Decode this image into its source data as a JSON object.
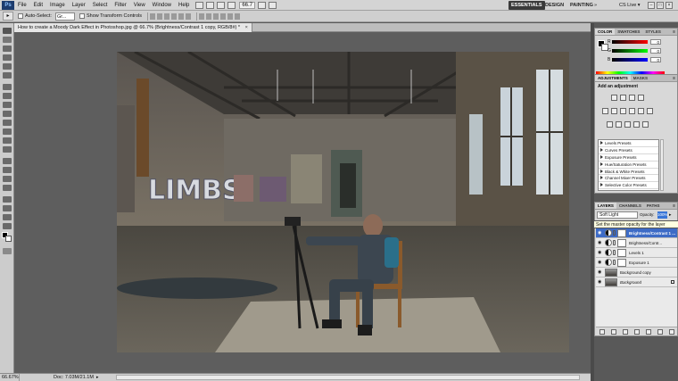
{
  "menubar": {
    "logo": "Ps",
    "items": [
      "File",
      "Edit",
      "Image",
      "Layer",
      "Select",
      "Filter",
      "View",
      "Window",
      "Help"
    ],
    "zoom": "66.7",
    "workspaces": [
      "ESSENTIALS",
      "DESIGN",
      "PAINTING",
      "»"
    ],
    "cs_live": "CS Live ▾",
    "window_buttons": [
      "–",
      "□",
      "×"
    ]
  },
  "options": {
    "auto_select_label": "Auto-Select:",
    "auto_select_value": "Gr...",
    "transform_label": "Show Transform Controls"
  },
  "document": {
    "tab_title": "How to create a Moody Dark Effect in Photoshop.jpg @ 66.7% (Brightness/Contrast 1 copy, RGB/8#) *",
    "close": "×"
  },
  "status": {
    "zoom": "66.67%",
    "doc": "Doc: 7.03M/21.1M",
    "arrow": "▸"
  },
  "color_panel": {
    "tabs": [
      "COLOR",
      "SWATCHES",
      "STYLES"
    ],
    "sliders": [
      {
        "label": "R",
        "value": "0"
      },
      {
        "label": "G",
        "value": "0"
      },
      {
        "label": "B",
        "value": "0"
      }
    ]
  },
  "adjustments_panel": {
    "tabs": [
      "ADJUSTMENTS",
      "MASKS"
    ],
    "title": "Add an adjustment",
    "presets": [
      "Levels Presets",
      "Curves Presets",
      "Exposure Presets",
      "Hue/Saturation Presets",
      "Black & White Presets",
      "Channel Mixer Presets",
      "Selective Color Presets"
    ]
  },
  "layers_panel": {
    "tabs": [
      "LAYERS",
      "CHANNELS",
      "PATHS"
    ],
    "blend_mode": "Soft Light",
    "opacity_label": "Opacity:",
    "opacity_value": "100%",
    "tooltip": "Set the master opacity for the layer",
    "layers": [
      {
        "name": "Brightness/Contrast 1 ...",
        "selected": true
      },
      {
        "name": "Brightness/Contr..."
      },
      {
        "name": "Levels 1"
      },
      {
        "name": "Exposure 1"
      },
      {
        "name": "Background copy"
      },
      {
        "name": "Background",
        "italic": true
      }
    ],
    "footer_icons": [
      "link-icon",
      "fx-icon",
      "mask-icon",
      "adjustment-icon",
      "folder-icon",
      "new-layer-icon",
      "trash-icon"
    ]
  },
  "colors": {
    "selection": "#3d6bc6",
    "opacity_highlight": "#3875d7",
    "tooltip_bg": "#ffffe1"
  }
}
